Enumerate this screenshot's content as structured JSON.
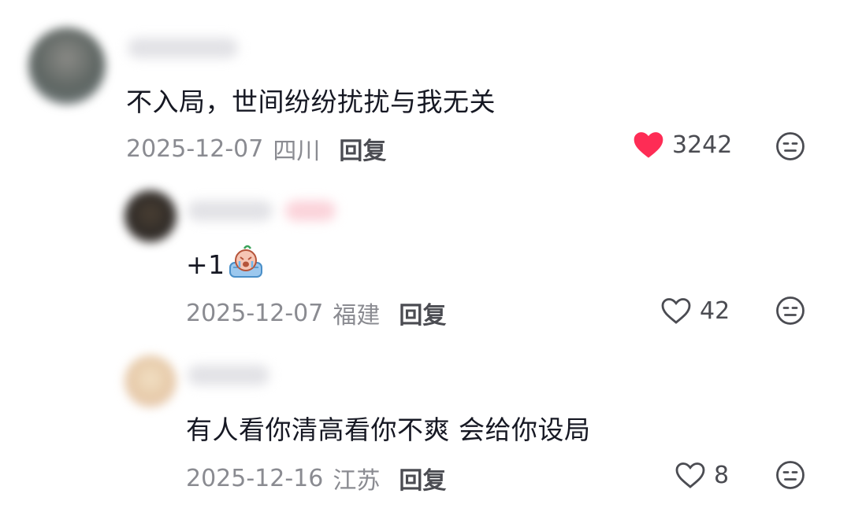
{
  "comments": [
    {
      "text": "不入局，世间纷纷扰扰与我无关",
      "date": "2025-12-07",
      "location": "四川",
      "reply_label": "回复",
      "likes": "3242",
      "liked": true,
      "like_icon": "heart-filled-icon",
      "dislike_icon": "meh-face-icon"
    },
    {
      "text": "+1",
      "date": "2025-12-07",
      "location": "福建",
      "reply_label": "回复",
      "likes": "42",
      "liked": false,
      "emoji": "crying-emoji",
      "like_icon": "heart-outline-icon",
      "dislike_icon": "meh-face-icon"
    },
    {
      "text": "有人看你清高看你不爽 会给你设局",
      "date": "2025-12-16",
      "location": "江苏",
      "reply_label": "回复",
      "likes": "8",
      "liked": false,
      "like_icon": "heart-outline-icon",
      "dislike_icon": "meh-face-icon"
    }
  ],
  "colors": {
    "liked_heart": "#fe2c55",
    "text_primary": "#161823",
    "text_secondary": "#8a8b91"
  }
}
